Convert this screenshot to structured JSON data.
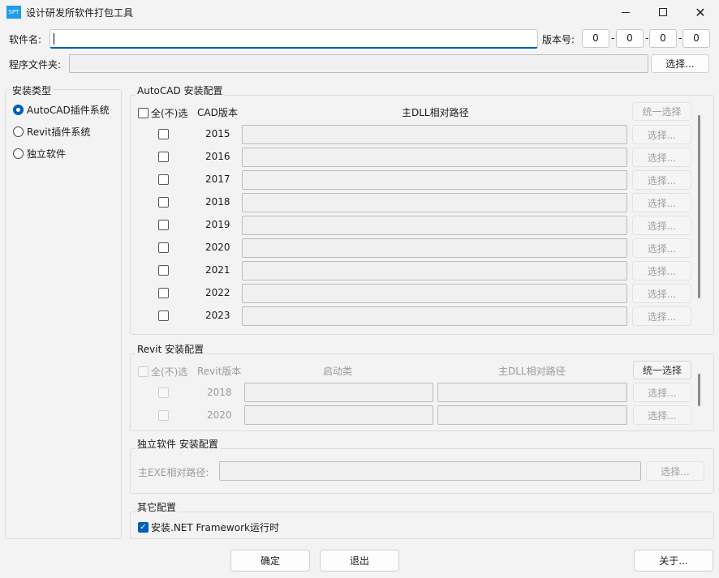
{
  "window": {
    "title": "设计研发所软件打包工具",
    "icon_text": "SPT"
  },
  "software_name": {
    "label": "软件名:",
    "value": ""
  },
  "version": {
    "label": "版本号:",
    "parts": [
      "0",
      "0",
      "0",
      "0"
    ],
    "separator": "-"
  },
  "program_folder": {
    "label": "程序文件夹:",
    "value": "",
    "button": "选择..."
  },
  "install_type": {
    "title": "安装类型",
    "options": [
      {
        "label": "AutoCAD插件系统",
        "selected": true
      },
      {
        "label": "Revit插件系统",
        "selected": false
      },
      {
        "label": "独立软件",
        "selected": false
      }
    ]
  },
  "autocad": {
    "title": "AutoCAD 安装配置",
    "select_all": "全(不)选",
    "col_version": "CAD版本",
    "col_path": "主DLL相对路径",
    "unify_button": "统一选择",
    "row_button": "选择...",
    "versions": [
      "2015",
      "2016",
      "2017",
      "2018",
      "2019",
      "2020",
      "2021",
      "2022",
      "2023"
    ]
  },
  "revit": {
    "title": "Revit 安装配置",
    "select_all": "全(不)选",
    "col_version": "Revit版本",
    "col_startup": "启动类",
    "col_path": "主DLL相对路径",
    "unify_button": "统一选择",
    "row_button": "选择...",
    "versions": [
      "2018",
      "2020"
    ]
  },
  "standalone": {
    "title": "独立软件 安装配置",
    "exe_label": "主EXE相对路径:",
    "button": "选择..."
  },
  "other": {
    "title": "其它配置",
    "dotnet_label": "安装.NET Framework运行时",
    "dotnet_checked": true
  },
  "footer": {
    "ok": "确定",
    "exit": "退出",
    "about": "关于..."
  }
}
